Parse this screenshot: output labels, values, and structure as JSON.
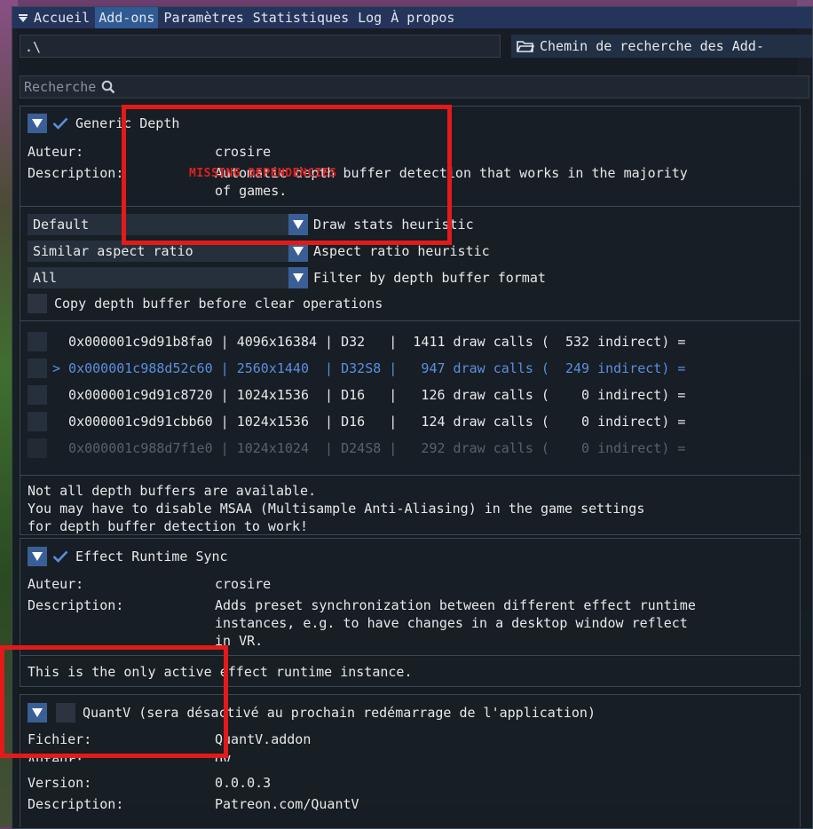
{
  "menu": {
    "tabs": [
      "Accueil",
      "Add-ons",
      "Paramètres",
      "Statistiques",
      "Log",
      "À propos"
    ],
    "active_tab": "Add-ons"
  },
  "path": {
    "value": ".\\",
    "button_label": "Chemin de recherche des Add-"
  },
  "search": {
    "placeholder": "Recherche"
  },
  "generic_depth": {
    "title": "Generic Depth",
    "author_label": "Auteur:",
    "author": "crosire",
    "description_label": "Description:",
    "description_line1": "Automatic depth buffer detection that works in the majority",
    "description_line2": "of games.",
    "missing_dependencies": "MISSING DEPENDENCIES",
    "settings": [
      {
        "value": "Default",
        "label": "Draw stats heuristic"
      },
      {
        "value": "Similar aspect ratio",
        "label": "Aspect ratio heuristic"
      },
      {
        "value": "All",
        "label": "Filter by depth buffer format"
      }
    ],
    "copy_before_clear_label": "Copy depth buffer before clear operations",
    "buffers": [
      {
        "text": "  0x000001c9d91b8fa0 | 4096x16384 | D32   |  1411 draw calls (  532 indirect) ="
      },
      {
        "text": "> 0x000001c988d52c60 | 2560x1440  | D32S8 |   947 draw calls (  249 indirect) ="
      },
      {
        "text": "  0x000001c9d91c8720 | 1024x1536  | D16   |   126 draw calls (    0 indirect) ="
      },
      {
        "text": "  0x000001c9d91cbb60 | 1024x1536  | D16   |   124 draw calls (    0 indirect) ="
      },
      {
        "text": "  0x000001c988d7f1e0 | 1024x1024  | D24S8 |   292 draw calls (    0 indirect) ="
      }
    ],
    "notice_line1": "Not all depth buffers are available.",
    "notice_line2": "You may have to disable MSAA (Multisample Anti-Aliasing) in the game settings",
    "notice_line3": "for depth buffer detection to work!"
  },
  "effect_runtime_sync": {
    "title": "Effect Runtime Sync",
    "author_label": "Auteur:",
    "author": "crosire",
    "description_label": "Description:",
    "description_line1": "Adds preset synchronization between different effect runtime",
    "description_line2": "instances, e.g. to have changes in a desktop window reflect",
    "description_line3": "in VR.",
    "status": "This is the only active effect runtime instance."
  },
  "quantv": {
    "title": "QuantV (sera désactivé au prochain redémarrage de l'application)",
    "file_label": "Fichier:",
    "file": "QuantV.addon",
    "author_label": "Auteur:",
    "author": "QV",
    "version_label": "Version:",
    "version": "0.0.0.3",
    "description_label": "Description:",
    "description": "Patreon.com/QuantV"
  },
  "colors": {
    "accent": "#3a5f96",
    "highlight": "#e31a1a",
    "menubar": "#25345a"
  }
}
